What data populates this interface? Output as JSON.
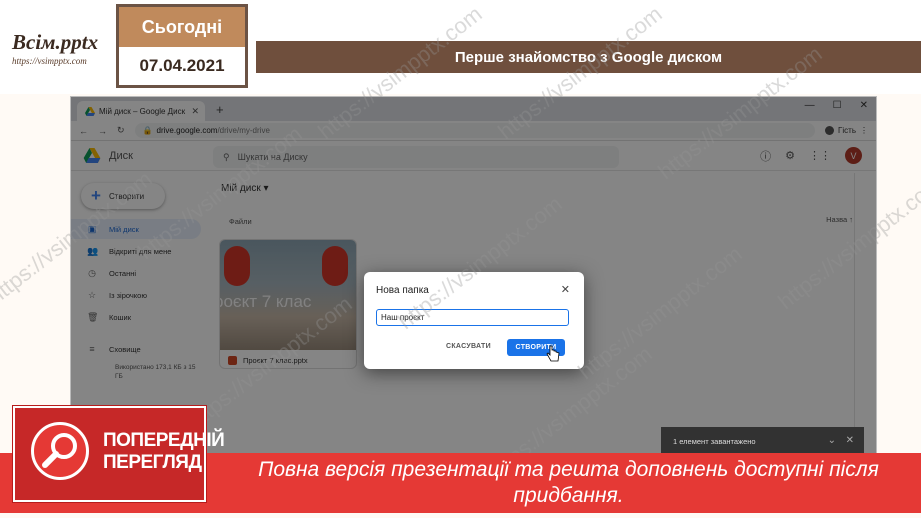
{
  "header": {
    "logo_text": "Всім.pptx",
    "logo_url": "https://vsimpptx.com",
    "date_label": "Сьогодні",
    "date_value": "07.04.2021",
    "slide_title": "Перше знайомство з Google диском"
  },
  "browser": {
    "tab_title": "Мій диск – Google Диск",
    "tab_close": "✕",
    "new_tab": "+",
    "window_controls": [
      "—",
      "☐",
      "✕"
    ],
    "url_host": "drive.google.com",
    "url_path": "/drive/my-drive",
    "profile_label": "Гість"
  },
  "drive": {
    "app_title": "Диск",
    "search_placeholder": "Шукати на Диску",
    "create_label": "Створити",
    "breadcrumb": "Мій диск",
    "files_label": "Файли",
    "sort_label": "Назва",
    "sidebar": [
      {
        "label": "Мій диск",
        "icon": "drive-folder-icon",
        "glyph": "▣"
      },
      {
        "label": "Відкриті для мене",
        "icon": "shared-icon",
        "glyph": "👥"
      },
      {
        "label": "Останні",
        "icon": "recent-icon",
        "glyph": "◷"
      },
      {
        "label": "Із зірочкою",
        "icon": "star-icon",
        "glyph": "☆"
      },
      {
        "label": "Кошик",
        "icon": "trash-icon",
        "glyph": "🗑"
      },
      {
        "label": "Сховище",
        "icon": "storage-icon",
        "glyph": "≡"
      }
    ],
    "storage_text": "Використано 173,1 КБ з 15 ГБ",
    "file_name": "Проєкт 7 клас.pptx",
    "file_thumb_text": "роєкт 7 клас"
  },
  "dialog": {
    "title": "Нова папка",
    "close": "✕",
    "input_value": "Наш проєкт",
    "cancel_label": "СКАСУВАТИ",
    "create_label": "СТВОРИТИ"
  },
  "toast": {
    "text": "1 елемент завантажено",
    "chevron": "⌄",
    "close": "✕"
  },
  "watermark": "https://vsimpptx.com",
  "banner": {
    "preview_line1": "ПОПЕРЕДНІЙ",
    "preview_line2": "ПЕРЕГЛЯД",
    "message": "Повна версія презентації та решта доповнень доступні після придбання."
  },
  "colors": {
    "title_bar": "#6f4f3d",
    "date_top": "#c08a5c",
    "banner_red": "#e53935",
    "drive_blue": "#1a73e8"
  }
}
